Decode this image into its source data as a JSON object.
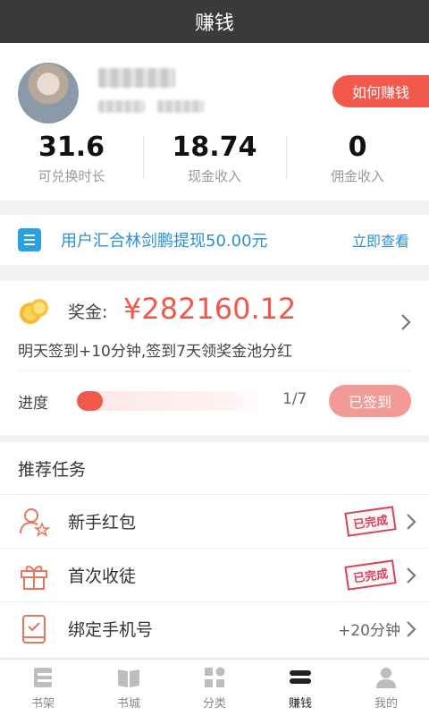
{
  "header": {
    "title": "赚钱"
  },
  "profile": {
    "howto_button": "如何赚钱",
    "stats": [
      {
        "value": "31.6",
        "label": "可兑换时长"
      },
      {
        "value": "18.74",
        "label": "现金收入"
      },
      {
        "value": "0",
        "label": "佣金收入"
      }
    ]
  },
  "notice": {
    "text": "用户汇合林剑鹏提现50.00元",
    "link": "立即查看"
  },
  "bonus": {
    "label": "奖金:",
    "amount": "¥282160.12",
    "description": "明天签到+10分钟,签到7天领奖金池分红",
    "progress_label": "进度",
    "progress_fraction": 0.14,
    "progress_count": "1/7",
    "signed_button": "已签到"
  },
  "tasks": {
    "title": "推荐任务",
    "items": [
      {
        "label": "新手红包",
        "status": "已完成",
        "icon": "user-star-icon"
      },
      {
        "label": "首次收徒",
        "status": "已完成",
        "icon": "gift-icon"
      },
      {
        "label": "绑定手机号",
        "reward": "+20分钟",
        "icon": "phone-icon"
      }
    ]
  },
  "tabbar": {
    "items": [
      {
        "label": "书架",
        "icon": "bookshelf-icon"
      },
      {
        "label": "书城",
        "icon": "book-icon"
      },
      {
        "label": "分类",
        "icon": "grid-icon"
      },
      {
        "label": "赚钱",
        "icon": "earn-icon",
        "active": true
      },
      {
        "label": "我的",
        "icon": "user-icon"
      }
    ]
  },
  "colors": {
    "accent": "#f2594d",
    "link": "#2a8fd6",
    "topbar": "#3a3a3a"
  }
}
